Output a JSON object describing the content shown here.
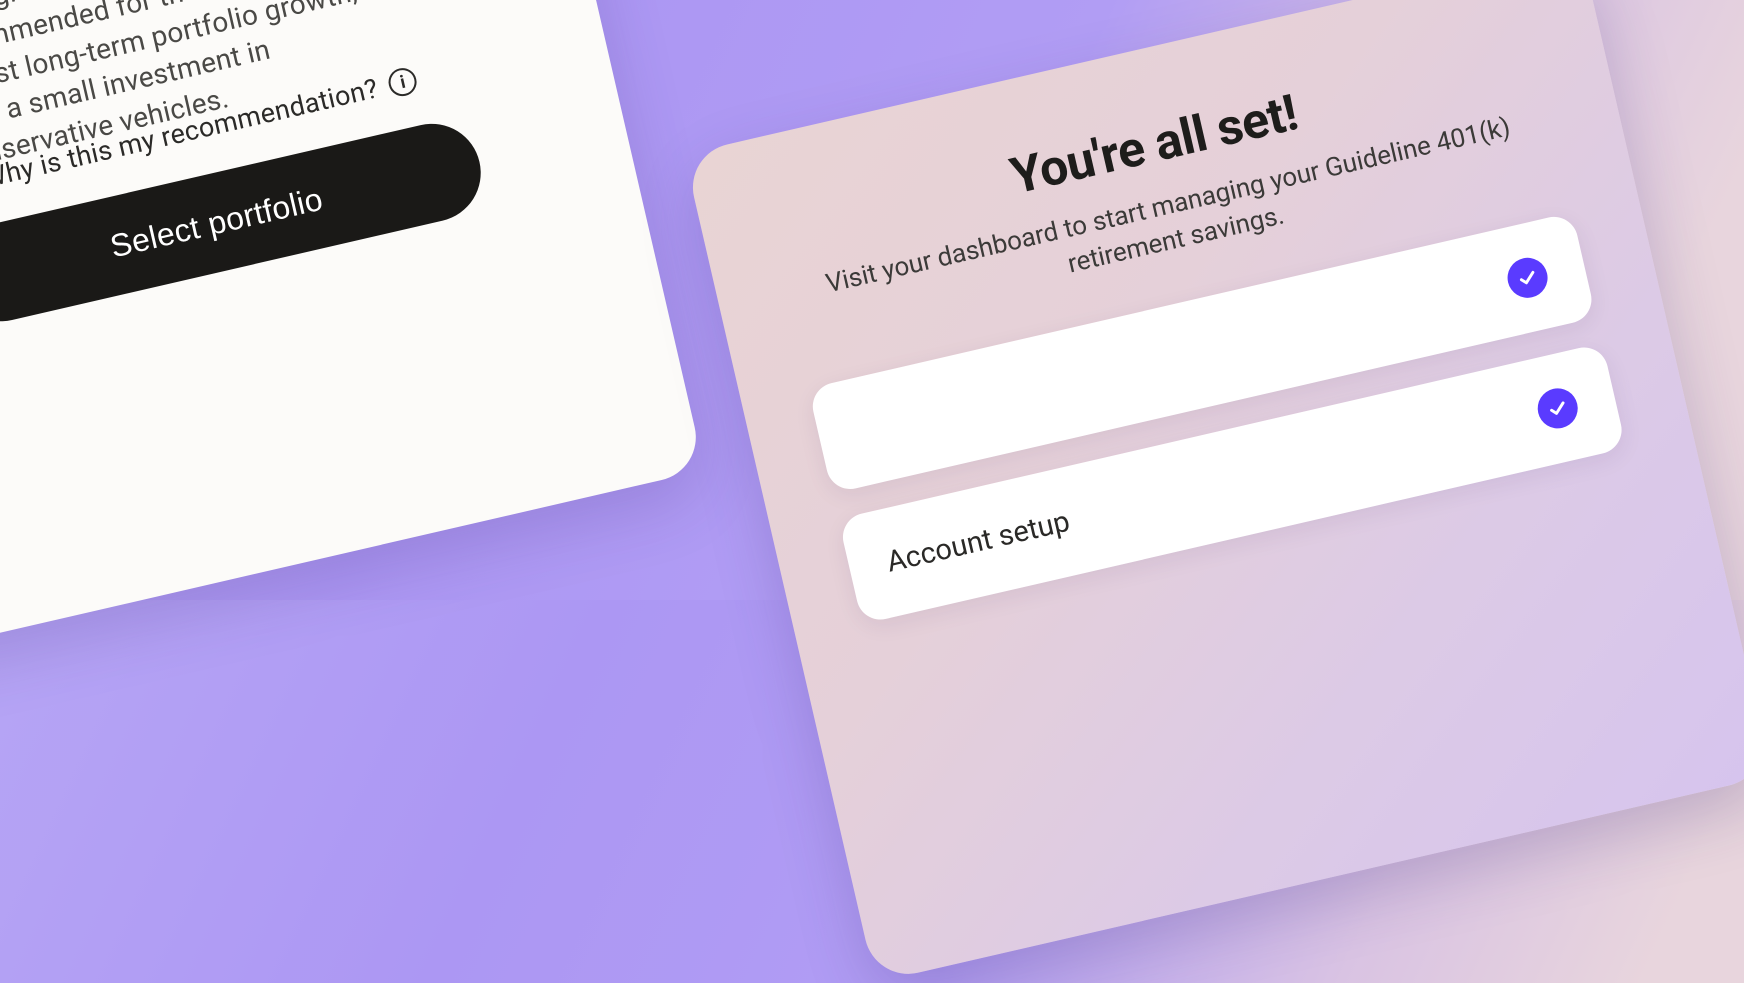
{
  "portfolio": {
    "description": "An aggressive portfolio is recommended for those looking for robust long-term portfolio growth, with a small investment in conservative vehicles.",
    "why_label": "Why is this my recommendation?",
    "select_button": "Select portfolio",
    "icon": "cash-bill-icon"
  },
  "confirmation": {
    "title": "You're all set!",
    "subtitle": "Visit your dashboard to start managing your Guideline 401(k) retirement savings.",
    "tasks": [
      {
        "label": "",
        "done": true
      },
      {
        "label": "Account setup",
        "done": true
      }
    ]
  },
  "colors": {
    "accent": "#5a3bff",
    "donut": "#9c8cf5",
    "button_bg": "#1a1917"
  }
}
